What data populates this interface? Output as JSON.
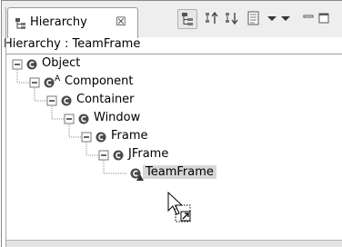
{
  "view": {
    "tab_label": "Hierarchy",
    "tab_close_symbol": "☒",
    "title": "Hierarchy : TeamFrame"
  },
  "toolbar": {
    "buttons": [
      {
        "name": "show-type-hierarchy-button",
        "icon": "type-hierarchy-icon",
        "active": true
      },
      {
        "name": "show-supertype-hierarchy-button",
        "icon": "supertype-hierarchy-icon"
      },
      {
        "name": "show-subtype-hierarchy-button",
        "icon": "subtype-hierarchy-icon"
      },
      {
        "name": "layout-button",
        "icon": "layout-icon"
      },
      {
        "name": "history-dropdown-button",
        "icon": "chevron-down-icon"
      },
      {
        "name": "view-menu-button",
        "icon": "chevron-down-icon"
      },
      {
        "name": "minimize-button",
        "icon": "minimize-icon"
      },
      {
        "name": "maximize-button",
        "icon": "maximize-icon"
      }
    ]
  },
  "tree": {
    "nodes": [
      {
        "label": "Object",
        "depth": 0,
        "icon": "class-icon",
        "abstract": false,
        "selected": false
      },
      {
        "label": "Component",
        "depth": 1,
        "icon": "class-icon",
        "abstract": true,
        "abstract_mark": "A",
        "selected": false
      },
      {
        "label": "Container",
        "depth": 2,
        "icon": "class-icon",
        "abstract": false,
        "selected": false
      },
      {
        "label": "Window",
        "depth": 3,
        "icon": "class-icon",
        "abstract": false,
        "selected": false
      },
      {
        "label": "Frame",
        "depth": 4,
        "icon": "class-icon",
        "abstract": false,
        "selected": false
      },
      {
        "label": "JFrame",
        "depth": 5,
        "icon": "class-icon",
        "abstract": false,
        "selected": false
      },
      {
        "label": "TeamFrame",
        "depth": 6,
        "icon": "focus-class-icon",
        "abstract": false,
        "selected": true
      }
    ],
    "expander_symbol": "−"
  },
  "colors": {
    "class_icon": "#4a4a4a",
    "selection": "#d7d7d7",
    "tree_line": "#8c8c8c"
  }
}
